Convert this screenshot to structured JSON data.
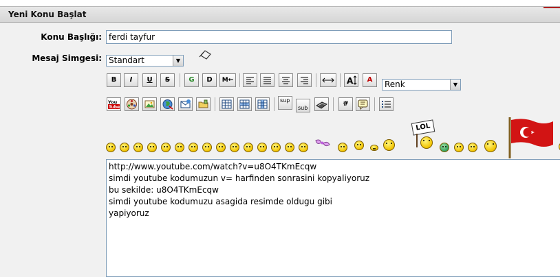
{
  "header": {
    "title": "Yeni Konu Başlat"
  },
  "form": {
    "subject_label": "Konu Başlığı:",
    "subject_value": "ferdi tayfur",
    "icon_label": "Mesaj Simgesi:",
    "icon_selected": "Standart",
    "color_selected": "Renk"
  },
  "toolbar": {
    "bold": "B",
    "italic": "I",
    "underline": "U",
    "strike": "S",
    "g_label": "G",
    "d_label": "D",
    "m_label": "M←",
    "sup": "sup",
    "sub": "sub",
    "hash": "#",
    "font_color_label": "A"
  },
  "lol_sign": "LOL",
  "message": {
    "lines": [
      "http://www.youtube.com/watch?v=u8O4TKmEcqw",
      "simdi youtube kodumuzun v= harfinden sonrasini kopyaliyoruz",
      "bu sekilde: u8O4TKmEcqw",
      "simdi youtube kodumuzu asagida resimde oldugu gibi",
      "yapiyoruz"
    ]
  },
  "colors": {
    "header_bg": "#d6d6d6",
    "panel_bg": "#f1f1f1",
    "border": "#7f9db9"
  }
}
